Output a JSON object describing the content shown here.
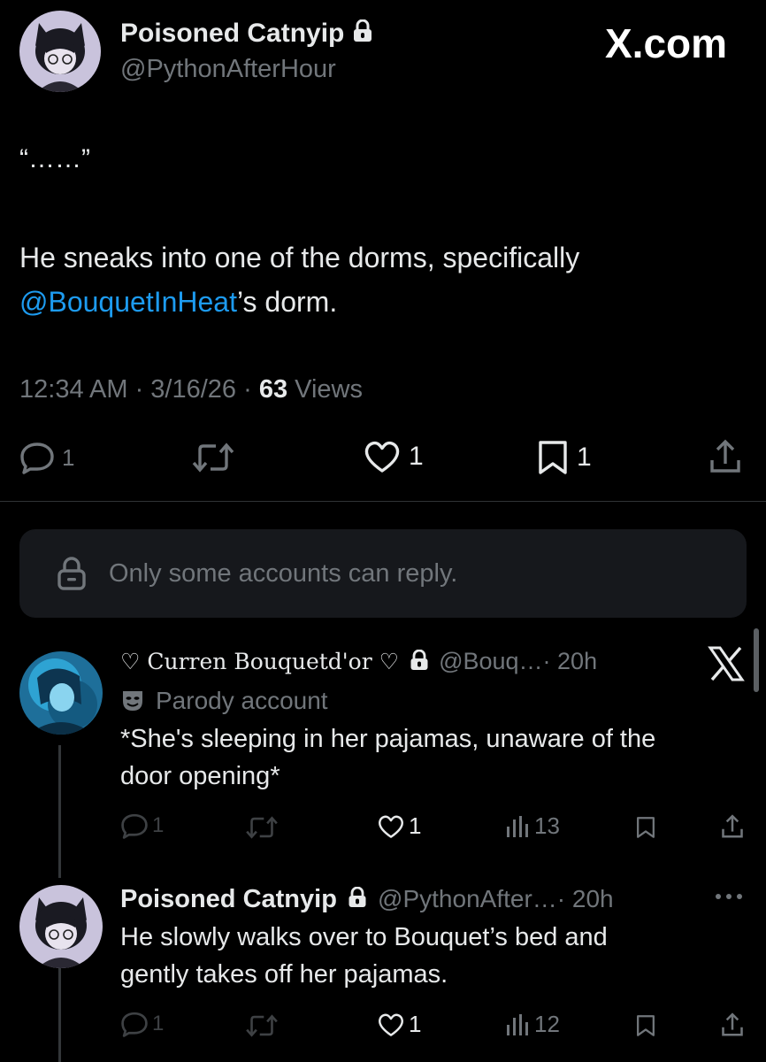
{
  "watermark": "X.com",
  "main_tweet": {
    "author_name": "Poisoned Catnyip",
    "author_handle": "@PythonAfterHour",
    "text_quote": "“……”",
    "text_line1": "He sneaks into one of the dorms, specifically",
    "text_mention": "@BouquetInHeat",
    "text_line2_rest": "’s dorm.",
    "timestamp": "12:34 AM · 3/16/26 · ",
    "views_count": "63",
    "views_label": " Views",
    "actions": {
      "replies": "1",
      "retweets": "",
      "likes": "1",
      "bookmarks": "1"
    }
  },
  "reply_restriction": {
    "text": "Only some accounts can reply."
  },
  "replies": [
    {
      "author_name": "♡ Curren Bouquetd'or ♡",
      "author_handle": "@Bouq…",
      "time": "· 20h",
      "badge_label": "Parody account",
      "text_line1": "*She's sleeping in her pajamas, unaware of the",
      "text_line2": "door opening*",
      "replies": "1",
      "likes": "1",
      "views": "13"
    },
    {
      "author_name": "Poisoned Catnyip",
      "author_handle": "@PythonAfter…",
      "time": "· 20h",
      "text_line1": "He slowly walks over to Bouquet’s bed and",
      "text_line2": "gently takes off her pajamas.",
      "replies": "1",
      "likes": "1",
      "views": "12"
    }
  ],
  "colors": {
    "background": "#000000",
    "text": "#e7e9ea",
    "secondary": "#71767b",
    "accent": "#1d9bf0"
  }
}
